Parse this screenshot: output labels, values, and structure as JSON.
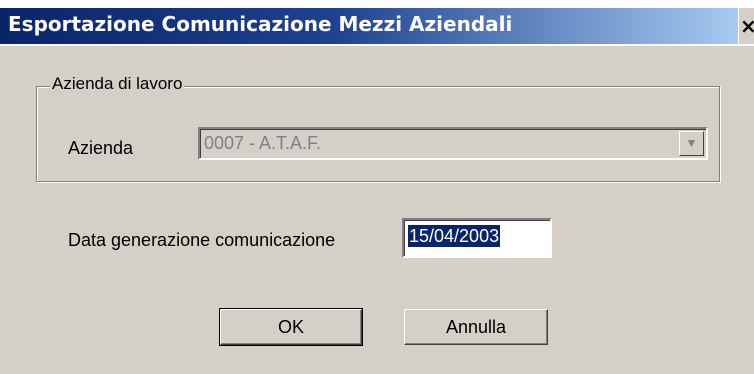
{
  "window": {
    "title": "Esportazione Comunicazione Mezzi Aziendali",
    "close_glyph": "×"
  },
  "group": {
    "legend": "Azienda di lavoro",
    "azienda_label": "Azienda",
    "azienda_value": "0007 - A.T.A.F.",
    "dropdown_glyph": "▼"
  },
  "date": {
    "label": "Data generazione comunicazione",
    "value": "15/04/2003"
  },
  "buttons": {
    "ok_label": "OK",
    "cancel_label": "Annulla"
  },
  "colors": {
    "titlebar_start": "#0a246a",
    "titlebar_end": "#a6caf0",
    "dialog_face": "#d4d0c8",
    "selection": "#0a246a"
  },
  "icons": {
    "close": "close-icon",
    "dropdown": "chevron-down-icon"
  }
}
